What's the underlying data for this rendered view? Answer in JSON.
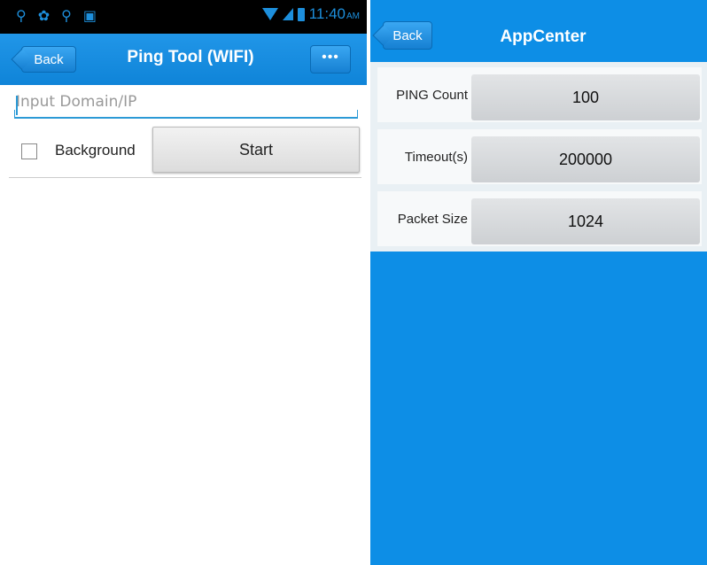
{
  "left": {
    "status": {
      "time": "11:40",
      "ampm": "AM",
      "icons": [
        "usb-icon",
        "settings-notification-icon",
        "usb-icon",
        "image-icon"
      ]
    },
    "navbar": {
      "back_label": "Back",
      "title": "Ping Tool (WIFI)",
      "menu_label": "•••"
    },
    "domain_input": {
      "placeholder": "Input Domain/IP",
      "value": ""
    },
    "background_label": "Background",
    "background_checked": false,
    "start_label": "Start"
  },
  "right": {
    "navbar": {
      "back_label": "Back",
      "title": "AppCenter"
    },
    "settings": [
      {
        "label": "PING Count",
        "value": "100"
      },
      {
        "label": "Timeout(s)",
        "value": "200000"
      },
      {
        "label": "Packet Size",
        "value": "1024"
      }
    ]
  },
  "colors": {
    "accent": "#1a8fe3",
    "background_right": "#0d8ee6",
    "status_bar": "#000000"
  }
}
